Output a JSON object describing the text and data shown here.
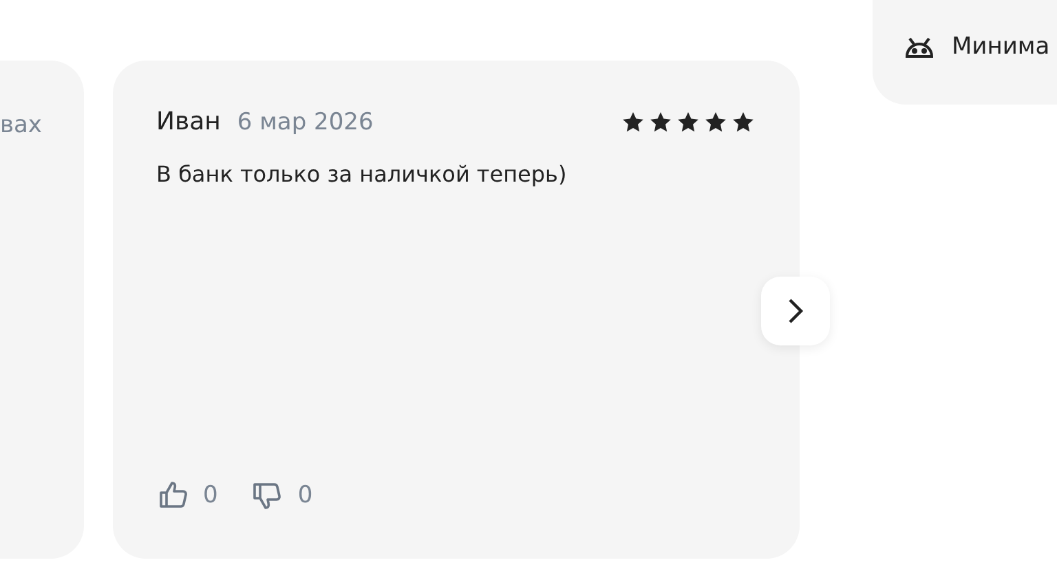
{
  "previous_review": {
    "text_fragment": "вах"
  },
  "review": {
    "author": "Иван",
    "date": "6 мар 2026",
    "stars": 5,
    "text": "В банк только за наличкой теперь)",
    "likes": "0",
    "dislikes": "0"
  },
  "side_panel": {
    "label": "Минима"
  }
}
